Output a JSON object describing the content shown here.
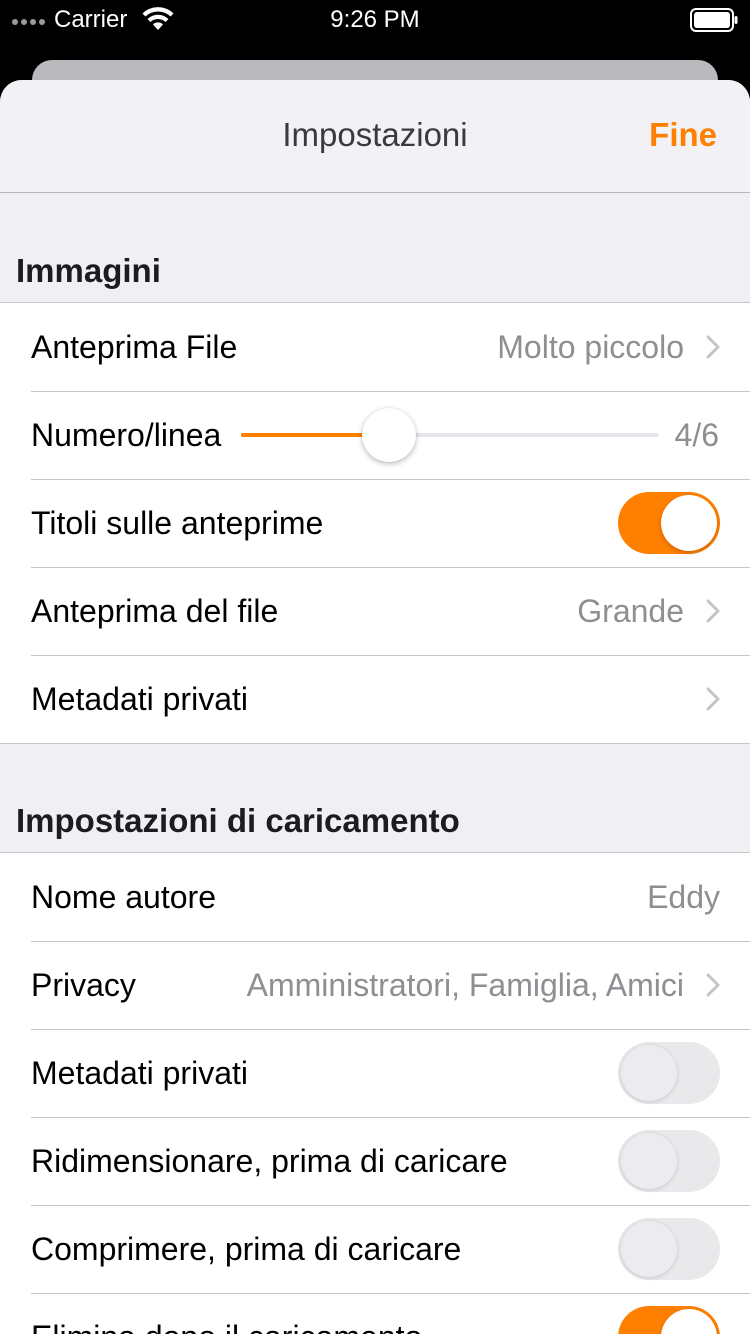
{
  "status_bar": {
    "carrier": "Carrier",
    "time": "9:26 PM"
  },
  "nav": {
    "title": "Impostazioni",
    "done_label": "Fine"
  },
  "accent_color": "#ff7f00",
  "sections": {
    "images": {
      "header": "Immagini",
      "file_preview": {
        "label": "Anteprima File",
        "value": "Molto piccolo"
      },
      "per_line": {
        "label": "Numero/linea",
        "value_text": "4/6",
        "slider_fraction": 0.353
      },
      "titles_on_previews": {
        "label": "Titoli sulle anteprime",
        "on": true
      },
      "file_preview_size": {
        "label": "Anteprima del file",
        "value": "Grande"
      },
      "private_metadata": {
        "label": "Metadati privati"
      }
    },
    "upload": {
      "header": "Impostazioni di caricamento",
      "author_name": {
        "label": "Nome autore",
        "value": "Eddy"
      },
      "privacy": {
        "label": "Privacy",
        "value": "Amministratori, Famiglia, Amici"
      },
      "strip_metadata": {
        "label": "Metadati privati",
        "on": false
      },
      "resize": {
        "label": "Ridimensionare, prima di caricare",
        "on": false
      },
      "compress": {
        "label": "Comprimere, prima di caricare",
        "on": false
      },
      "delete_after": {
        "label": "Elimina dopo il caricamento",
        "on": true
      }
    }
  }
}
